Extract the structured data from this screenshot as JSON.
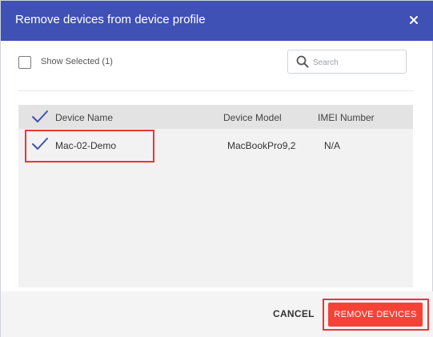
{
  "dialog": {
    "title": "Remove devices from device profile",
    "close_icon": "close-icon"
  },
  "toolbar": {
    "show_selected_label": "Show Selected (1)",
    "show_selected_checked": false,
    "search": {
      "placeholder": "Search",
      "value": "",
      "icon": "search-icon"
    }
  },
  "table": {
    "columns": [
      "Device Name",
      "Device Model",
      "IMEI Number"
    ],
    "header_check_icon": "checkmark-icon",
    "rows": [
      {
        "selected": true,
        "device_name": "Mac-02-Demo",
        "device_model": "MacBookPro9,2",
        "imei": "N/A"
      }
    ]
  },
  "footer": {
    "cancel_label": "CANCEL",
    "remove_label": "REMOVE DEVICES"
  },
  "colors": {
    "header_bg": "#3f51b5",
    "primary_button": "#f44336",
    "highlight_border": "#e53935",
    "checkmark": "#3f51b5"
  }
}
